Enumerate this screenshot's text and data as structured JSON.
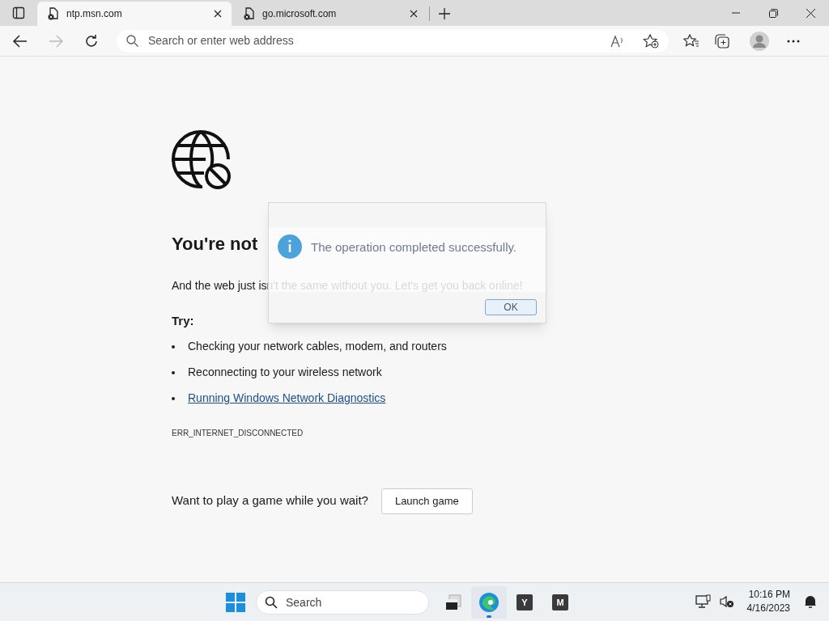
{
  "tabs": [
    {
      "title": "ntp.msn.com",
      "selected": true
    },
    {
      "title": "go.microsoft.com",
      "selected": false
    }
  ],
  "address_bar": {
    "placeholder": "Search or enter web address"
  },
  "page": {
    "heading": "You're not",
    "message": "And the web just isn't the same without you. Let's get you back online!",
    "try_label": "Try:",
    "suggestions": [
      {
        "text": "Checking your network cables, modem, and routers",
        "kind": "text"
      },
      {
        "text": "Reconnecting to your wireless network",
        "kind": "text"
      },
      {
        "text": "Running Windows Network Diagnostics",
        "kind": "link"
      }
    ],
    "error_code": "ERR_INTERNET_DISCONNECTED",
    "game_prompt": "Want to play a game while you wait?",
    "game_button": "Launch game"
  },
  "dialog": {
    "message": "The operation completed successfully.",
    "button": "OK"
  },
  "taskbar": {
    "search_label": "Search",
    "apps": [
      {
        "kind": "explorer",
        "selected": false
      },
      {
        "kind": "edge",
        "selected": true
      },
      {
        "kind": "letter",
        "label": "Y",
        "selected": false
      },
      {
        "kind": "letter",
        "label": "M",
        "selected": false
      }
    ],
    "time": "10:16 PM",
    "date": "4/16/2023"
  }
}
